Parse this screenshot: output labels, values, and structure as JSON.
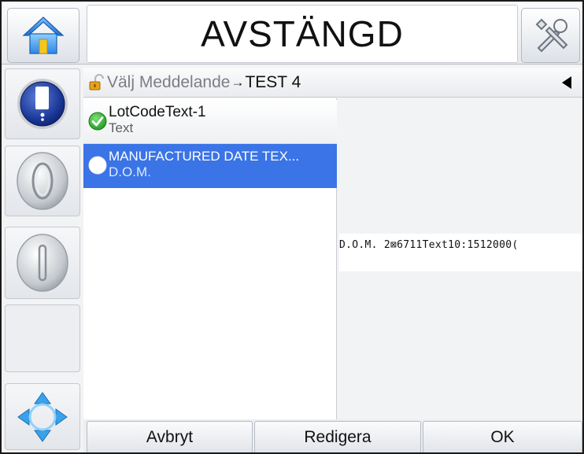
{
  "header": {
    "status": "AVSTÄNGD",
    "home_icon": "home-icon",
    "tools_icon": "tools-icon"
  },
  "left_rail": {
    "message_icon": "message-icon",
    "start_icon": "start-icon",
    "stop_icon": "stop-icon",
    "navigate_icon": "navigate-icon"
  },
  "breadcrumb": {
    "root": "Välj Meddelande",
    "separator": "→",
    "current": "TEST 4",
    "lock_icon": "lock-icon",
    "back_icon": "back-triangle-icon"
  },
  "fields": [
    {
      "name": "LotCodeText-1",
      "type": "Text",
      "status_icon": "checkmark-icon",
      "selected": false
    },
    {
      "name": "MANUFACTURED DATE TEX...",
      "type": "D.O.M.",
      "status_icon": "empty-circle-icon",
      "selected": true
    }
  ],
  "preview": {
    "text": "D.O.M. 2⊠6711Text10:1512000("
  },
  "buttons": {
    "cancel": "Avbryt",
    "edit": "Redigera",
    "ok": "OK"
  },
  "colors": {
    "selection": "#3a74e6",
    "frame": "#1a1a1a",
    "check_green": "#2fae2f"
  }
}
